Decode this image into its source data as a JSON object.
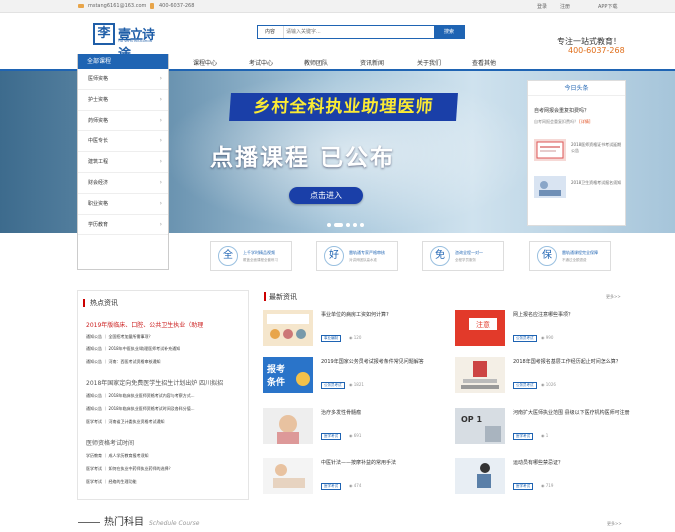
{
  "topbar": {
    "email": "mstang6161@163.com",
    "phone": "400-6037-268",
    "login": "登录",
    "register": "注册",
    "app": "APP下载"
  },
  "logo": {
    "char": "李",
    "name": "壹立诗途",
    "en": "YILI SHITU EDUCATION"
  },
  "search": {
    "category": "内容",
    "placeholder": "请输入关键字...",
    "button": "搜索"
  },
  "header": {
    "slogan": "专注一站式教育！",
    "phone": "400-6037-268"
  },
  "nav": {
    "items": [
      "课程中心",
      "考试中心",
      "教师团队",
      "资讯新闻",
      "关于我们",
      "查看其他"
    ]
  },
  "menu": {
    "title": "全部课程",
    "items": [
      "医师资格",
      "护士资格",
      "药师资格",
      "中医专长",
      "建筑工程",
      "财会经济",
      "职业资格",
      "学历教育"
    ]
  },
  "banner": {
    "title1": "乡村全科执业助理医师",
    "title2": "点播课程 已公布",
    "button": "点击进入",
    "slides": 5,
    "active_slide": 2
  },
  "today": {
    "title": "今日头条",
    "q1": "自考网报会重复扣费吗？",
    "a1_text": "自考网报会重复扣费吗？",
    "a1_link": "[详情]",
    "items": [
      "2018医师资格证书考试延期公告",
      "2018卫生资格考试报名须知"
    ]
  },
  "features": [
    {
      "icon": "全",
      "t1": "上千学时精品视频",
      "t2": "覆盖全面课程全套练习"
    },
    {
      "icon": "好",
      "t1": "雷轨通专家严格审核",
      "t2": "对讲师团队高水准"
    },
    {
      "icon": "免",
      "t1": "咨询全程一对一",
      "t2": "全程学员服务"
    },
    {
      "icon": "保",
      "t1": "雷轨通课程完全保障",
      "t2": "不通过全额退费"
    }
  ],
  "hot": {
    "title": "热点资讯",
    "headline1": "2019年版临床、口腔、公共卫生执业（助理",
    "list1": [
      "通知公告 ｜ 全国招考加量所需事项？",
      "通知公告 ｜ 2018年中医执业/助理医师考试补充通知",
      "通知公告 ｜ 河南：西医考试资格审核通知"
    ],
    "headline2": "2018年国家定向免费医学生招生计划出炉 四川拟招",
    "list2": [
      "通知公告 ｜ 2018年临床执业医师资格考试内容与考察方式...",
      "通知公告 ｜ 2018年临床执业医师资格考试时间及各科分值...",
      "医学考试 ｜ 河南省卫计委执业资格考试通知"
    ],
    "headline3": "医师资格考试时间",
    "list3": [
      "学历教育 ｜ 成人学历教育报考须知",
      "医学考试 ｜ 如何在执业中药师执业药师的选择？",
      "医学考试 ｜ 经络的生理功能"
    ]
  },
  "latest": {
    "title": "最新资讯",
    "more": "更多>>",
    "news": [
      {
        "title": "事业单位的病房工资如何计算?",
        "tag": "事业编制",
        "views": "120"
      },
      {
        "title": "网上报名应注意哪些事项？",
        "tag": "公务员考试",
        "views": "990"
      },
      {
        "title": "2019年国家公务员考试报考条件常见问题解答",
        "tag": "公务员考试",
        "views": "1821"
      },
      {
        "title": "2018年国考报名基层工作经历起止时间怎么算？",
        "tag": "公务员考试",
        "views": "1026"
      },
      {
        "title": "治疗多发性骨髓瘤",
        "tag": "医学考试",
        "views": "691"
      },
      {
        "title": "河南扩大医师执业范围 县级以下医疗机构医师可注册",
        "tag": "医学考试",
        "views": "1"
      },
      {
        "title": "中医针法——按摩补益的常用手法",
        "tag": "医学考试",
        "views": "474"
      },
      {
        "title": "运动员有哪些禁忌证？",
        "tag": "医学考试",
        "views": "719"
      }
    ]
  },
  "schedule": {
    "title": "热门科目",
    "en": "Schedule Course",
    "more": "更多>>"
  },
  "colors": {
    "brand": "#1f64b3",
    "accent": "#e06e1a",
    "headline": "#cc2020"
  }
}
